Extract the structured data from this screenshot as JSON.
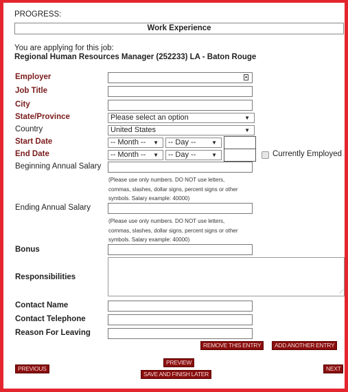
{
  "progress": {
    "label": "PROGRESS:",
    "step": "Work Experience"
  },
  "job": {
    "intro": "You are applying for this job:",
    "title": "Regional Human Resources Manager (252233) LA - Baton Rouge"
  },
  "fields": {
    "employer": {
      "label": "Employer",
      "value": ""
    },
    "job_title": {
      "label": "Job Title",
      "value": ""
    },
    "city": {
      "label": "City",
      "value": ""
    },
    "state": {
      "label": "State/Province",
      "selected": "Please select an option"
    },
    "country": {
      "label": "Country",
      "selected": "United States"
    },
    "start_date": {
      "label": "Start Date",
      "month": "-- Month --",
      "day": "-- Day --",
      "year": ""
    },
    "end_date": {
      "label": "End Date",
      "month": "-- Month --",
      "day": "-- Day --",
      "year": ""
    },
    "currently_employed": {
      "label": "Currently Employed",
      "checked": false
    },
    "beginning_salary": {
      "label": "Beginning Annual Salary",
      "value": "",
      "hint": "(Please use only numbers. DO NOT use letters, commas, slashes, dollar signs, percent signs or other symbols. Salary example: 40000)"
    },
    "ending_salary": {
      "label": "Ending Annual Salary",
      "value": "",
      "hint": "(Please use only numbers. DO NOT use letters, commas, slashes, dollar signs, percent signs or other symbols. Salary example: 40000)"
    },
    "bonus": {
      "label": "Bonus",
      "value": ""
    },
    "responsibilities": {
      "label": "Responsibilities",
      "value": ""
    },
    "contact_name": {
      "label": "Contact Name",
      "value": ""
    },
    "contact_telephone": {
      "label": "Contact Telephone",
      "value": ""
    },
    "reason_for_leaving": {
      "label": "Reason For Leaving",
      "value": ""
    }
  },
  "buttons": {
    "remove_entry": "REMOVE THIS ENTRY",
    "add_entry": "ADD ANOTHER ENTRY",
    "previous": "PREVIOUS",
    "preview": "PREVIEW",
    "save_later": "SAVE AND FINISH LATER",
    "next": "NEXT"
  },
  "icons": {
    "dropdown_arrow": "▼",
    "autofill": "contact-card-icon"
  },
  "colors": {
    "frame_border": "#e3262e",
    "required_label": "#7a1a1a",
    "button_bg": "#8a0d0d"
  }
}
